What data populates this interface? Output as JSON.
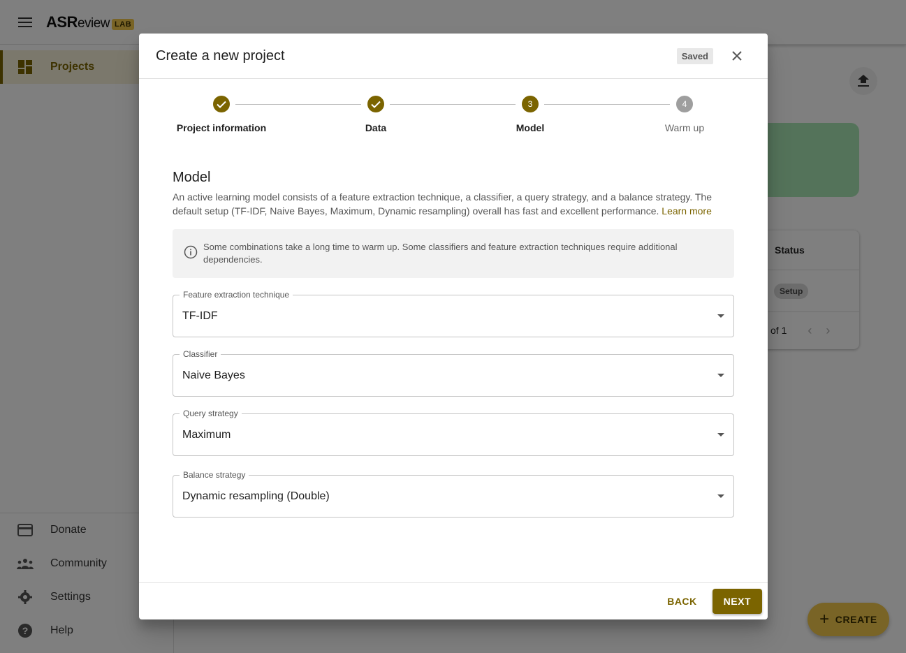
{
  "app": {
    "logo_main": "ASR",
    "logo_light": "eview",
    "logo_badge": "LAB"
  },
  "drawer": {
    "items": [
      {
        "label": "Projects",
        "icon": "dashboard-icon"
      }
    ],
    "bottom_items": [
      {
        "label": "Donate",
        "icon": "credit-card-icon"
      },
      {
        "label": "Community",
        "icon": "groups-icon"
      },
      {
        "label": "Settings",
        "icon": "gear-icon"
      },
      {
        "label": "Help",
        "icon": "help-icon"
      }
    ]
  },
  "background_table": {
    "status_header": "Status",
    "row_status": "Setup",
    "pagination": "of 1"
  },
  "create_fab": {
    "label": "CREATE"
  },
  "dialog": {
    "title": "Create a new project",
    "saved_badge": "Saved",
    "steps": [
      {
        "label": "Project information",
        "state": "completed",
        "number": "1"
      },
      {
        "label": "Data",
        "state": "completed",
        "number": "2"
      },
      {
        "label": "Model",
        "state": "active",
        "number": "3"
      },
      {
        "label": "Warm up",
        "state": "inactive",
        "number": "4"
      }
    ],
    "section_title": "Model",
    "description": "An active learning model consists of a feature extraction technique, a classifier, a query strategy, and a balance strategy. The default setup (TF-IDF, Naive Bayes, Maximum, Dynamic resampling) overall has fast and excellent performance.",
    "learn_more": "Learn more",
    "alert": "Some combinations take a long time to warm up. Some classifiers and feature extraction techniques require additional dependencies.",
    "fields": {
      "feature_extraction": {
        "label": "Feature extraction technique",
        "value": "TF-IDF"
      },
      "classifier": {
        "label": "Classifier",
        "value": "Naive Bayes"
      },
      "query_strategy": {
        "label": "Query strategy",
        "value": "Maximum"
      },
      "balance_strategy": {
        "label": "Balance strategy",
        "value": "Dynamic resampling (Double)"
      }
    },
    "back_label": "BACK",
    "next_label": "NEXT"
  },
  "colors": {
    "accent": "#7b6400",
    "lab_badge": "#f2c94c",
    "fab": "#f2c94c"
  }
}
